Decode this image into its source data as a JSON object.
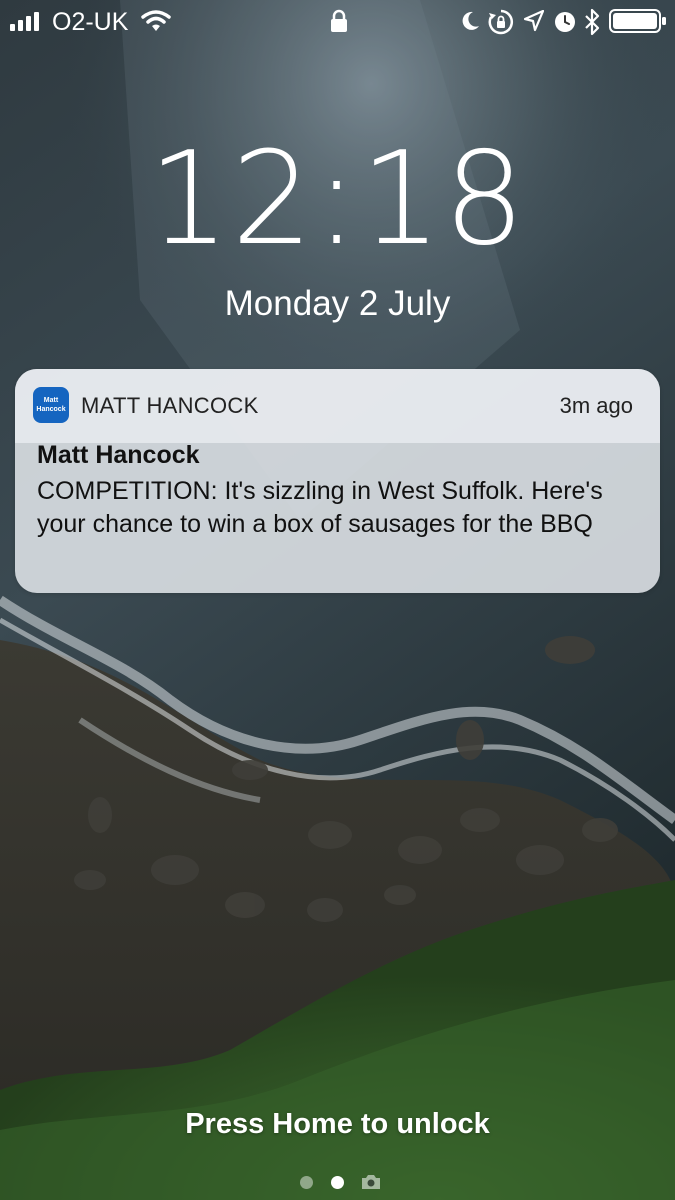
{
  "status_bar": {
    "carrier": "O2-UK",
    "signal_bars": 4,
    "icons": [
      "signal-icon",
      "wifi-icon",
      "lock-icon",
      "moon-icon",
      "rotation-lock-icon",
      "location-icon",
      "alarm-icon",
      "bluetooth-icon",
      "battery-icon"
    ],
    "battery_level": 1.0
  },
  "lock_screen": {
    "time": "12:18",
    "date": "Monday 2 July"
  },
  "notification": {
    "app_icon_text": [
      "Matt",
      "Hancock"
    ],
    "app_icon_color": "#1565c0",
    "app_name": "MATT HANCOCK",
    "time_ago": "3m ago",
    "title": "Matt Hancock",
    "body": "COMPETITION: It's sizzling in West Suffolk. Here's your chance to win a box of sausages for the BBQ"
  },
  "bottom": {
    "unlock_hint": "Press Home to unlock",
    "pages": [
      "dot",
      "dot-active",
      "camera-icon"
    ]
  }
}
